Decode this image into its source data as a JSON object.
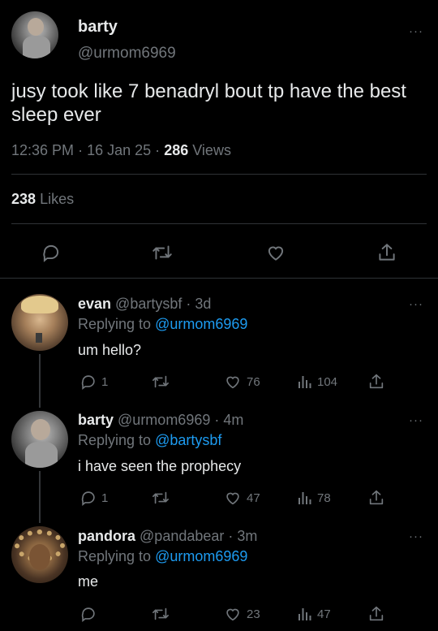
{
  "main_tweet": {
    "display_name": "barty",
    "handle": "@urmom6969",
    "text": "jusy took like 7 benadryl bout tp have the best sleep ever",
    "time": "12:36 PM",
    "date": "16 Jan 25",
    "views_count": "286",
    "views_label": "Views",
    "likes_count": "238",
    "likes_label": "Likes",
    "more": "···"
  },
  "replies": [
    {
      "display_name": "evan",
      "handle": "@bartysbf",
      "age": "3d",
      "replying_to_label": "Replying to",
      "replying_to": "@urmom6969",
      "text": "um hello?",
      "reply_count": "1",
      "retweet_count": "",
      "like_count": "76",
      "view_count": "104",
      "more": "···"
    },
    {
      "display_name": "barty",
      "handle": "@urmom6969",
      "age": "4m",
      "replying_to_label": "Replying to",
      "replying_to": "@bartysbf",
      "text": "i have seen the prophecy",
      "reply_count": "1",
      "retweet_count": "",
      "like_count": "47",
      "view_count": "78",
      "more": "···"
    },
    {
      "display_name": "pandora",
      "handle": "@pandabear",
      "age": "3m",
      "replying_to_label": "Replying to",
      "replying_to": "@urmom6969",
      "text": "me",
      "reply_count": "",
      "retweet_count": "",
      "like_count": "23",
      "view_count": "47",
      "more": "···"
    }
  ],
  "separator": "·",
  "colors": {
    "background": "#000000",
    "text": "#e7e9ea",
    "muted": "#71767b",
    "link": "#1d9bf0",
    "divider": "#2f3336"
  },
  "icons": [
    "reply-icon",
    "retweet-icon",
    "like-icon",
    "share-icon",
    "views-icon",
    "more-icon"
  ]
}
